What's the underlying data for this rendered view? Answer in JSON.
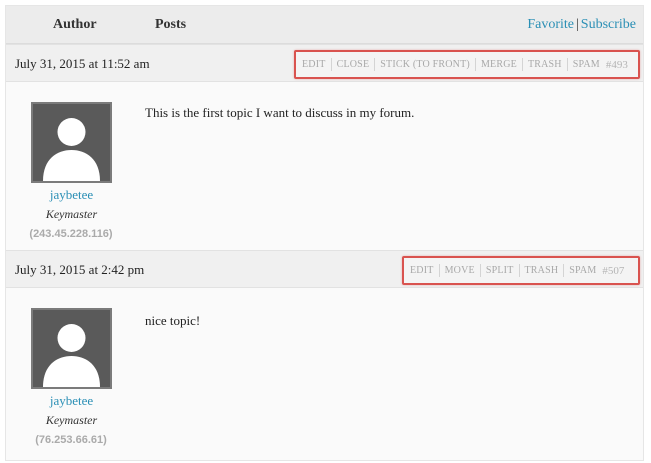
{
  "header": {
    "author_label": "Author",
    "posts_label": "Posts",
    "favorite_label": "Favorite",
    "separator": "|",
    "subscribe_label": "Subscribe"
  },
  "posts": [
    {
      "date": "July 31, 2015 at 11:52 am",
      "actions": [
        "EDIT",
        "CLOSE",
        "STICK (TO FRONT)",
        "MERGE",
        "TRASH",
        "SPAM"
      ],
      "post_id": "#493",
      "author": {
        "name": "jaybetee",
        "role": "Keymaster",
        "ip": "(243.45.228.116)"
      },
      "content": "This is the first topic I want to discuss in my forum."
    },
    {
      "date": "July 31, 2015 at 2:42 pm",
      "actions": [
        "EDIT",
        "MOVE",
        "SPLIT",
        "TRASH",
        "SPAM"
      ],
      "post_id": "#507",
      "author": {
        "name": "jaybetee",
        "role": "Keymaster",
        "ip": "(76.253.66.61)"
      },
      "content": "nice topic!"
    }
  ],
  "colors": {
    "link": "#2a8fb5",
    "highlight_border": "#d9534f",
    "action_text": "#a8a8a8"
  }
}
